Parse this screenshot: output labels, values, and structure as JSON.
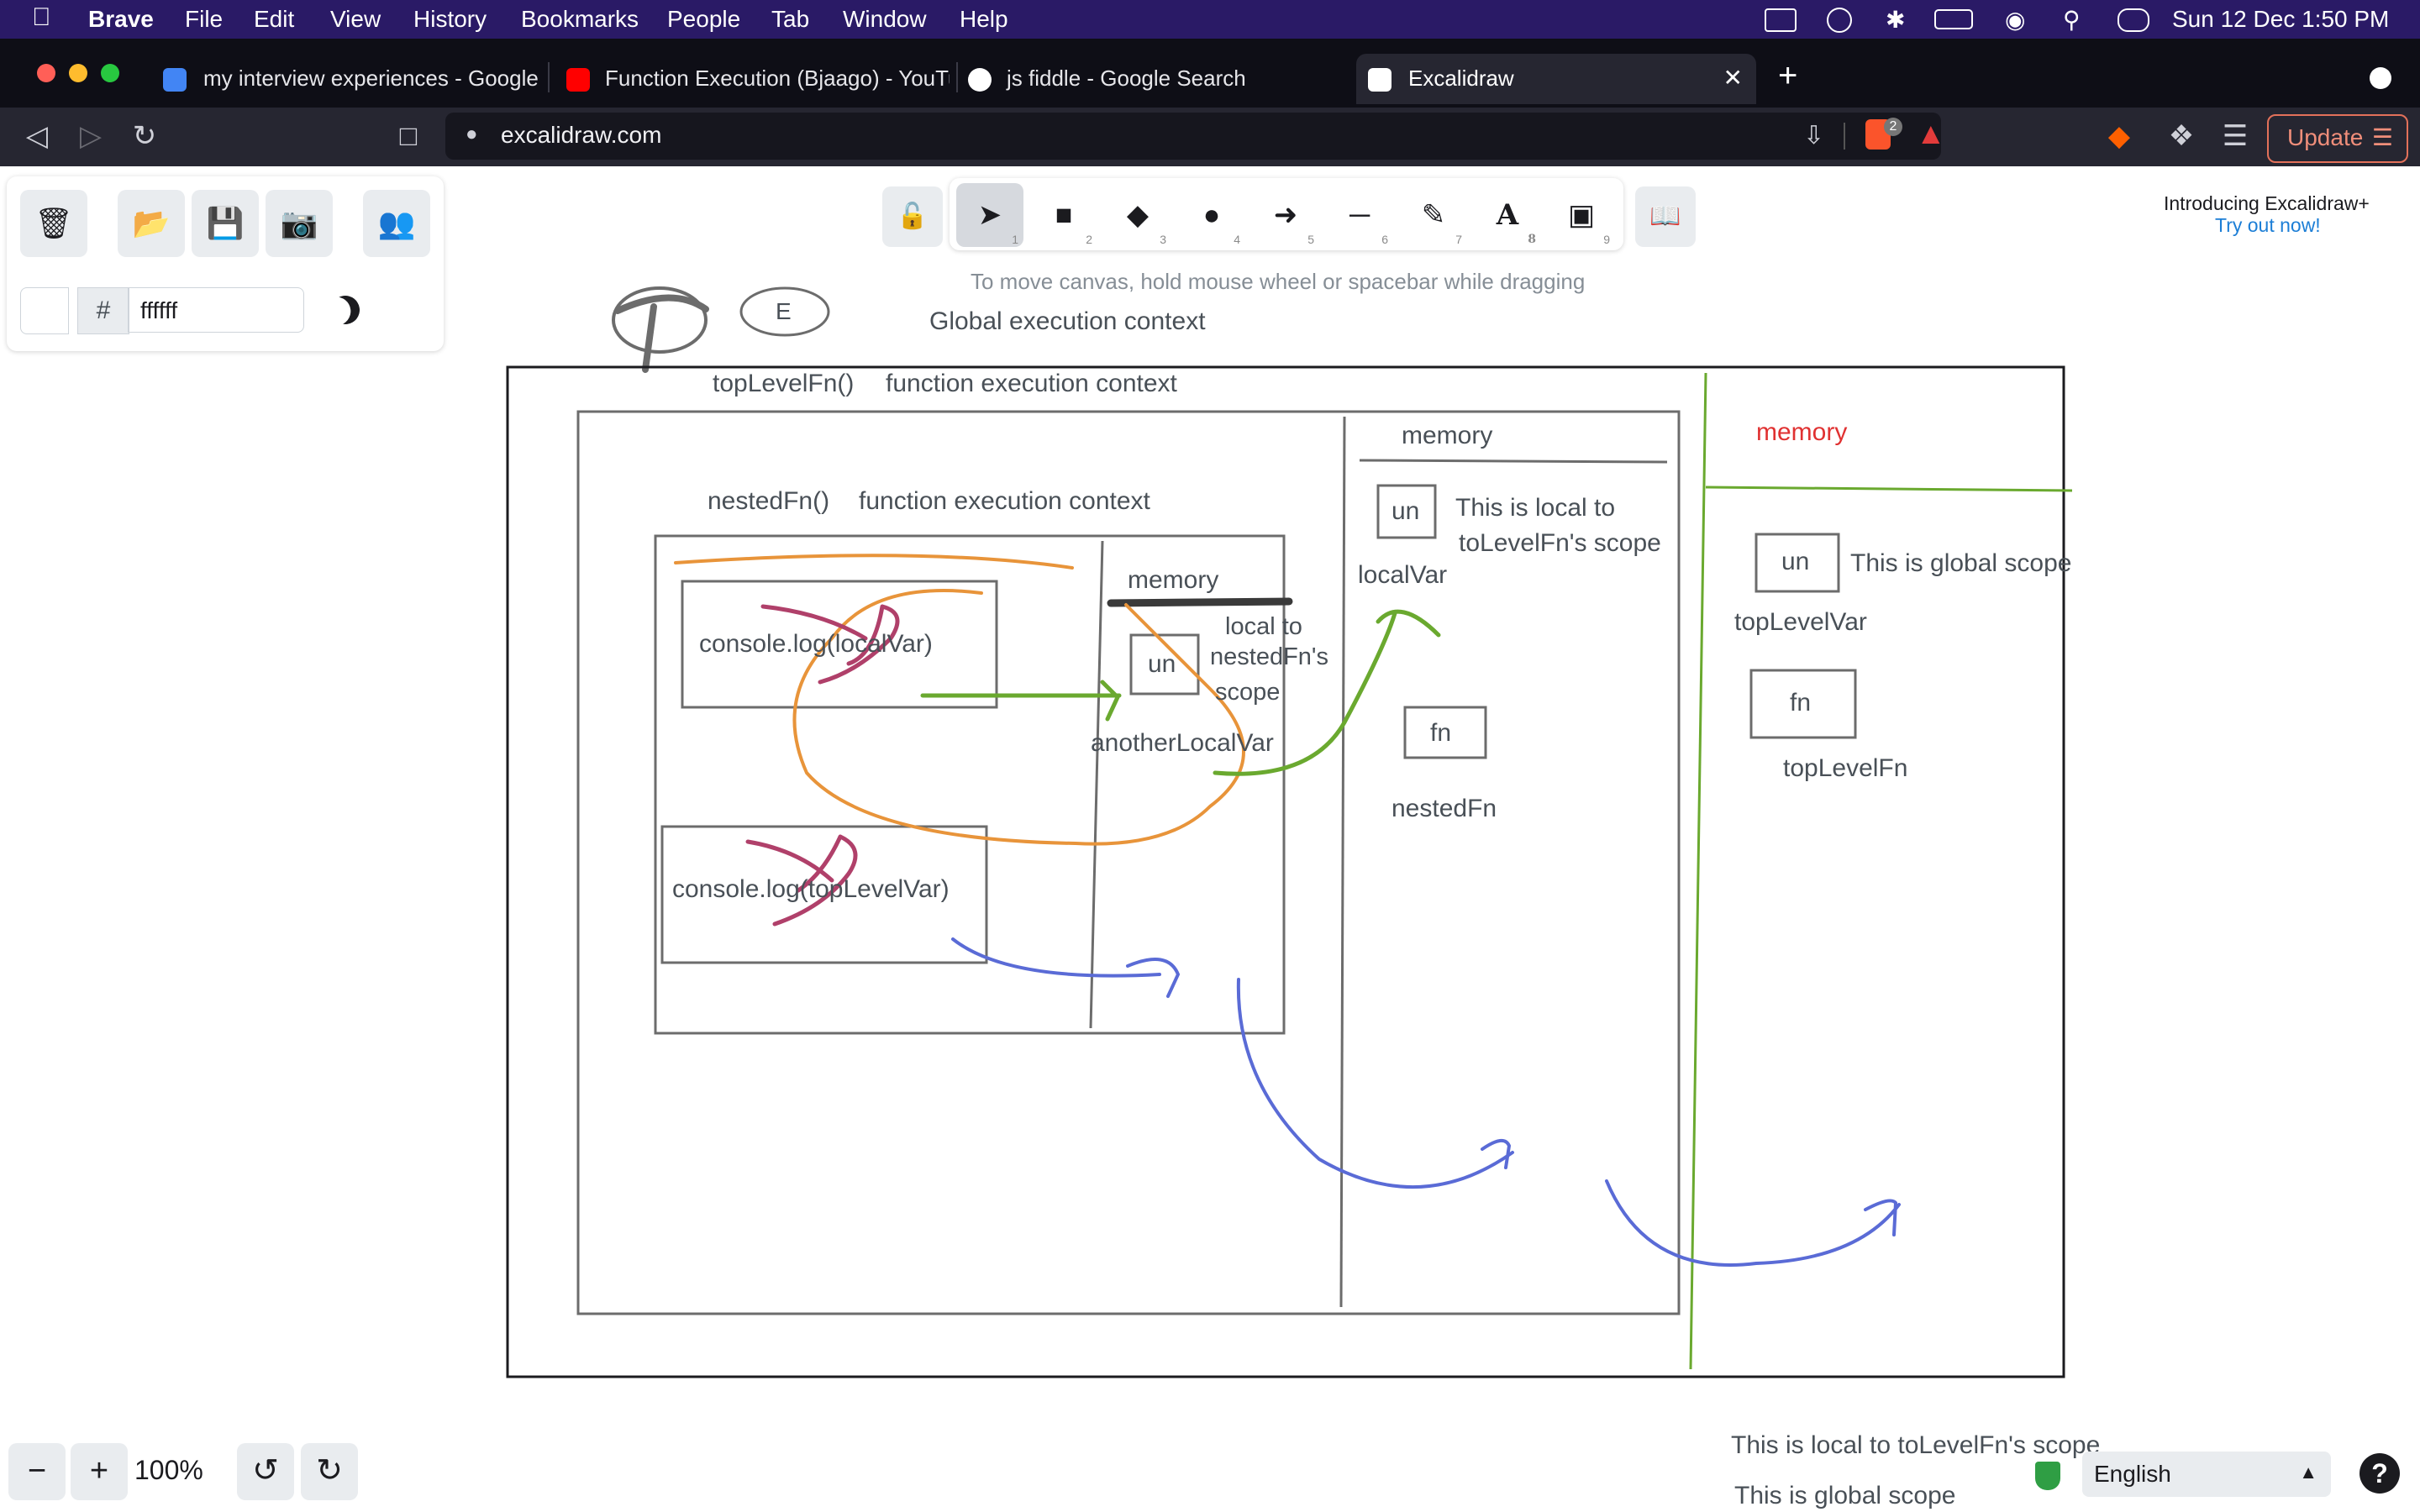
{
  "menubar": {
    "app": "Brave",
    "items": [
      "File",
      "Edit",
      "View",
      "History",
      "Bookmarks",
      "People",
      "Tab",
      "Window",
      "Help"
    ],
    "clock": "Sun 12 Dec  1:50 PM"
  },
  "tabs": [
    {
      "title": "my interview experiences - Google D",
      "color": "#4285f4"
    },
    {
      "title": "Function Execution (Bjaago) - YouTu",
      "color": "#ff0000"
    },
    {
      "title": "js fiddle - Google Search",
      "color": "#ffffff"
    },
    {
      "title": "Excalidraw",
      "color": "#ffffff"
    }
  ],
  "browser": {
    "url": "excalidraw.com",
    "shields_count": "2",
    "update_label": "Update"
  },
  "panel": {
    "color_hash": "#",
    "color_value": "ffffff"
  },
  "tools": {
    "keys": [
      "1",
      "2",
      "3",
      "4",
      "5",
      "6",
      "7",
      "8",
      "9"
    ],
    "hint": "To move canvas, hold mouse wheel or spacebar while dragging"
  },
  "promo": {
    "title": "Introducing Excalidraw+",
    "link": "Try out now!"
  },
  "canvas": {
    "global_title": "Global execution context",
    "top_fn": "topLevelFn()",
    "top_fn_ctx": "function execution context",
    "nested_fn": "nestedFn()",
    "nested_fn_ctx": "function execution context",
    "log_local": "console.log(localVar)",
    "log_top": "console.log(topLevelVar)",
    "nested_memory": "memory",
    "nested_un": "un",
    "nested_note_1": "local to",
    "nested_note_2": "nestedFn's",
    "nested_note_3": "scope",
    "another_local": "anotherLocalVar",
    "top_memory": "memory",
    "top_un": "un",
    "top_note_1": "This is local to",
    "top_note_2": "toLevelFn's scope",
    "local_var": "localVar",
    "top_fn_box": "fn",
    "nested_fn_name": "nestedFn",
    "global_memory": "memory",
    "global_un": "un",
    "global_note": "This is global scope",
    "top_level_var": "topLevelVar",
    "global_fn_box": "fn",
    "top_level_fn_name": "topLevelFn",
    "bottom_note_1": "This is local to toLevelFn's scope",
    "bottom_note_2": "This is global scope",
    "e_label": "E"
  },
  "footer": {
    "zoom": "100%",
    "language": "English",
    "help": "?"
  },
  "colors": {
    "orange": "#e8943a",
    "green": "#6aa92f",
    "blue": "#5a6bd6",
    "magenta": "#b0406a",
    "red_text": "#e03131"
  }
}
